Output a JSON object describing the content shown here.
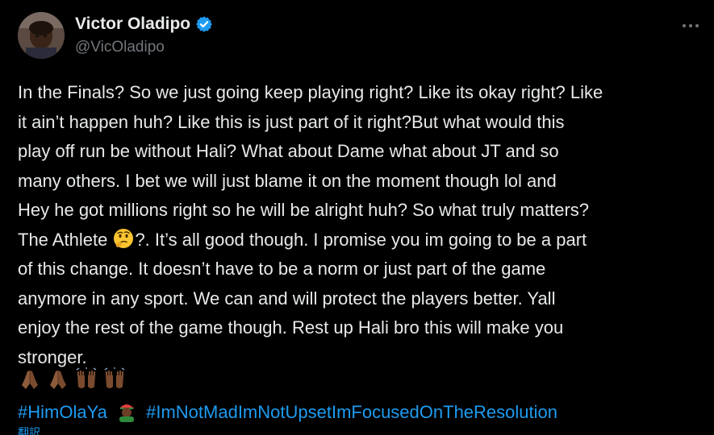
{
  "author": {
    "display_name": "Victor Oladipo",
    "handle": "@VicOladipo",
    "verified": true
  },
  "more_icon": "more-horizontal-icon",
  "tweet": {
    "lines": [
      "In the Finals? So we just going keep playing right? Like its okay right? Like",
      "it ain’t happen huh? Like this is just part of it right?But what would this",
      "play off run be without Hali? What about Dame what about JT and so",
      "many others. I bet we will just blame it on the moment though lol and",
      "Hey he got millions right so he will be alright huh? So what truly matters?",
      "The Athlete",
      "?. It’s all good though. I promise you im going to be a part",
      "of this change. It doesn’t have to be a norm or just part of the game",
      "anymore in any sport. We can and will protect the players better. Yall",
      "enjoy the rest of the game though. Rest up Hali bro this will make you",
      "stronger."
    ],
    "inline_emoji": "thinking-face",
    "emoji_row": [
      "folded-hands",
      "folded-hands",
      "raising-hands",
      "raising-hands"
    ],
    "hashtags": [
      "#HimOlaYa",
      "#ImNotMadImNotUpsetImFocusedOnTheResolution"
    ],
    "hashtag_emoji": "person-in-cap",
    "truncated_line": "翻訳"
  },
  "colors": {
    "background": "#000000",
    "text": "#e7e9ea",
    "secondary": "#71767b",
    "link": "#1d9bf0"
  }
}
